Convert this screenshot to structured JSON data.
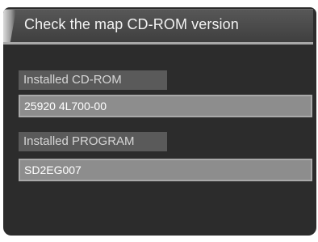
{
  "screen": {
    "title": "Check the map CD-ROM version"
  },
  "installed_cdrom": {
    "label": "Installed CD-ROM",
    "value": "25920 4L700-00"
  },
  "installed_program": {
    "label": "Installed PROGRAM",
    "value": "SD2EG007"
  }
}
